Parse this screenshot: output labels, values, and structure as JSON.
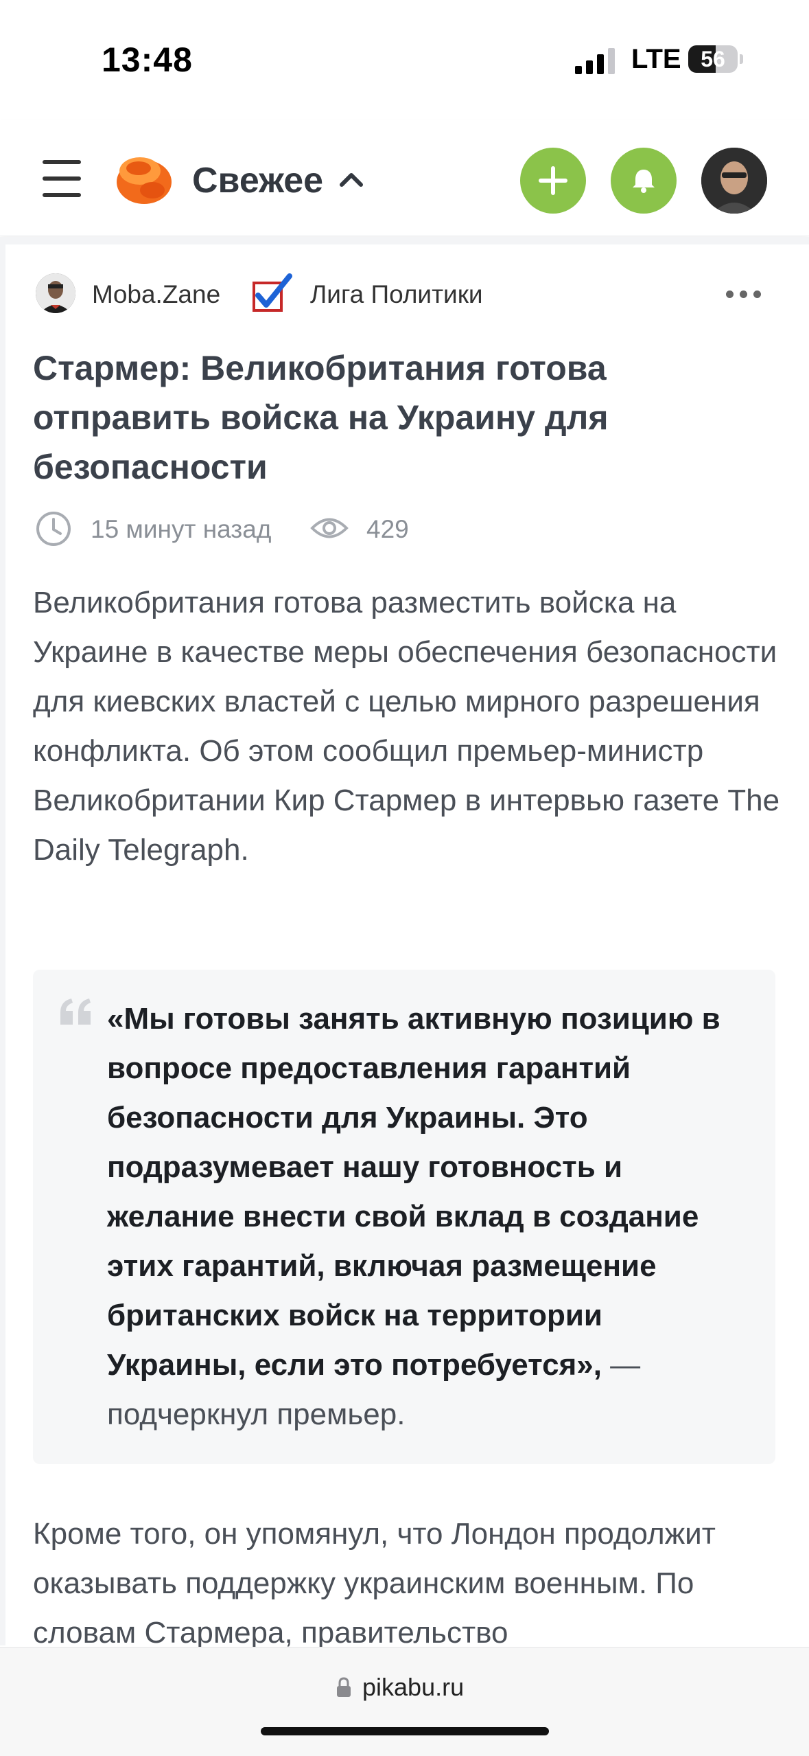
{
  "status_bar": {
    "time": "13:48",
    "network": "LTE",
    "battery": "56",
    "battery_level": 0.56,
    "icons": [
      "signal-bars-icon",
      "battery-icon"
    ]
  },
  "header": {
    "feed_title": "Свежее",
    "icons": [
      "hamburger-menu-icon",
      "pikabu-logo",
      "chevron-up-icon",
      "plus-icon",
      "bell-icon",
      "user-avatar"
    ],
    "accent_color": "#8bc34a"
  },
  "post": {
    "author": "Moba.Zane",
    "community": "Лига Политики",
    "title": "Стармер: Великобритания готова отправить войска на Украину для безопасности",
    "time_ago": "15 минут назад",
    "views": "429",
    "paragraph1": "Великобритания готова разместить войска на Украине в качестве меры обеспечения безопасности для киевских властей с целью мирного разрешения конфликта. Об этом сообщил премьер-министр Великобритании Кир Стармер в интервью газете The Daily Telegraph.",
    "quote_bold": "«Мы готовы занять активную позицию в вопросе предоставления гарантий безопасности для Украины. Это подразумевает нашу готовность и желание внести свой вклад в создание этих гарантий, включая размещение британских войск на территории Украины, если это потребуется»,",
    "quote_tail": " — подчеркнул премьер.",
    "paragraph2": "Кроме того, он упомянул, что Лондон продолжит оказывать поддержку украинским военным. По словам Стармера, правительство"
  },
  "browser": {
    "url": "pikabu.ru"
  }
}
